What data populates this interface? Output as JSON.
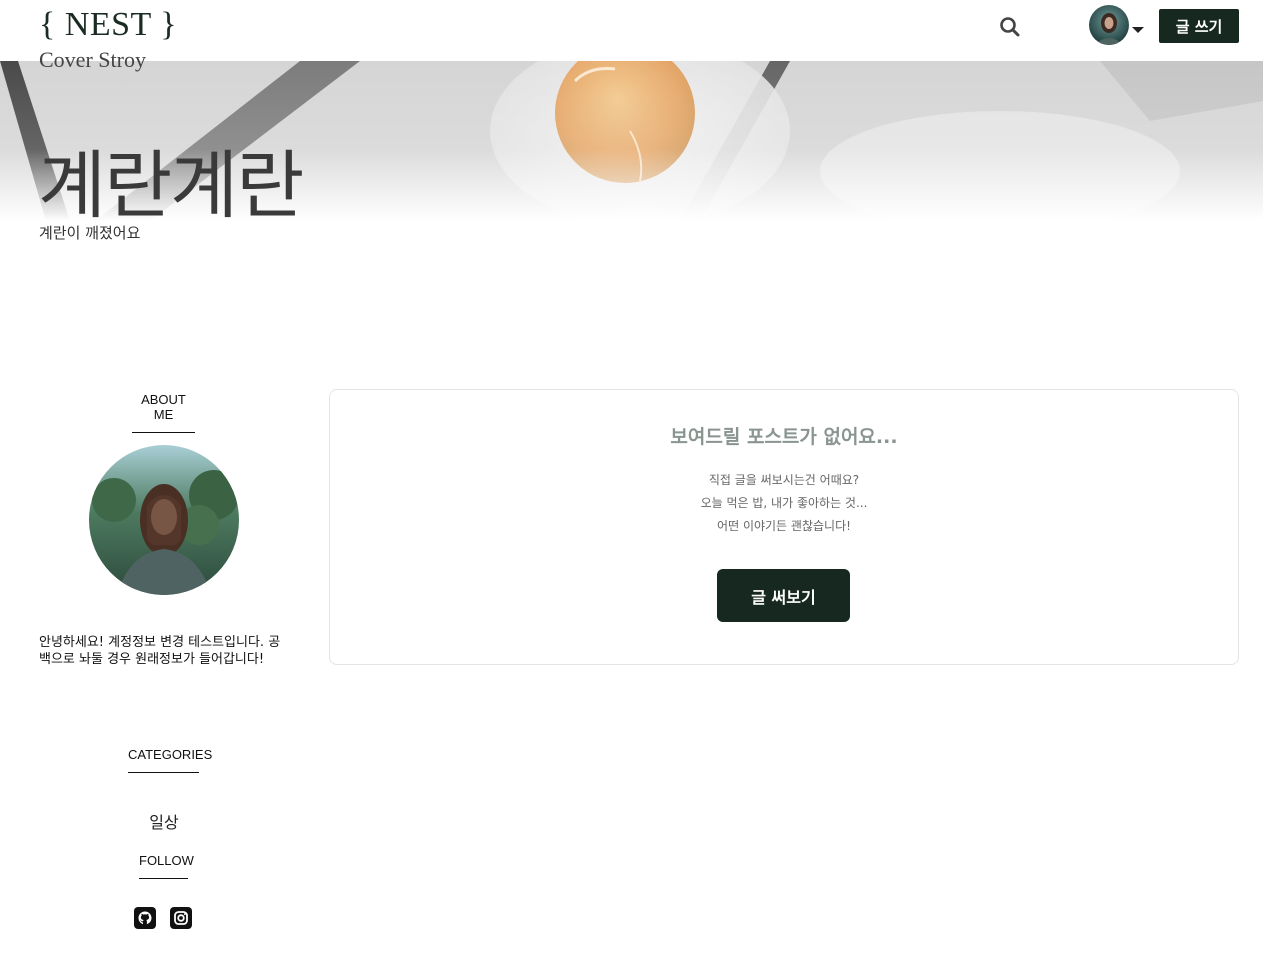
{
  "header": {
    "logo": "{ NEST }",
    "write_label": "글 쓰기"
  },
  "cover": {
    "label": "Cover Stroy",
    "title": "계란계란",
    "subtitle": "계란이 깨졌어요"
  },
  "sidebar": {
    "about_title": "ABOUT ME",
    "bio": "안녕하세요! 계정정보 변경 테스트입니다. 공백으로 놔둘 경우 원래정보가 들어갑니다!",
    "categories_title": "CATEGORIES",
    "categories": [
      "일상"
    ],
    "follow_title": "FOLLOW",
    "social_icons": [
      "github-icon",
      "instagram-icon"
    ]
  },
  "main": {
    "empty_title": "보여드릴 포스트가 없어요...",
    "empty_lines": [
      "직접 글을 써보시는건 어때요?",
      "오늘 먹은 밥, 내가 좋아하는 것...",
      "어떤 이야기든 괜찮습니다!"
    ],
    "write_try_label": "글 써보기"
  },
  "colors": {
    "primary": "#16281f",
    "muted_title": "#8a9590"
  }
}
